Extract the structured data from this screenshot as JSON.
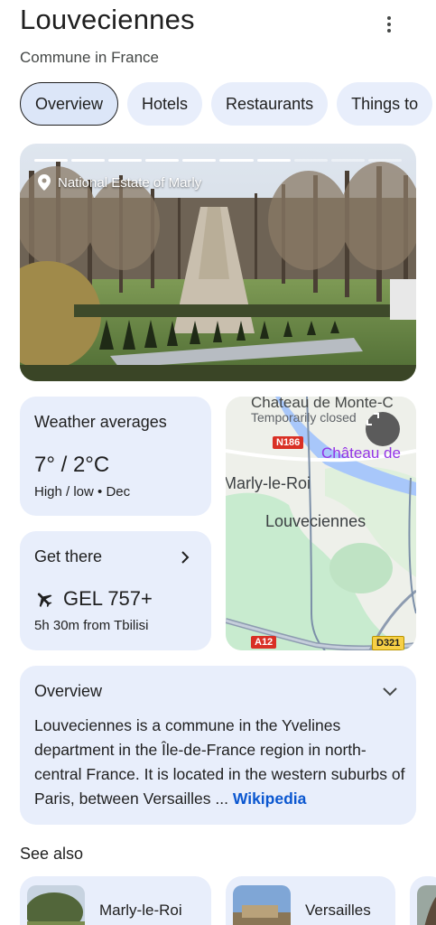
{
  "header": {
    "title": "Louveciennes",
    "subtitle": "Commune in France"
  },
  "chips": [
    {
      "label": "Overview"
    },
    {
      "label": "Hotels"
    },
    {
      "label": "Restaurants"
    },
    {
      "label": "Things to"
    }
  ],
  "hero": {
    "caption": "National Estate of Marly",
    "slides_total": 10,
    "slides_viewed": 7
  },
  "weather": {
    "title": "Weather averages",
    "temperature": "7° / 2°C",
    "detail": "High / low • Dec"
  },
  "get_there": {
    "title": "Get there",
    "price": "GEL 757+",
    "detail": "5h 30m from Tbilisi"
  },
  "map": {
    "place_top": "Chateau de Monte-C",
    "status": "Temporarily closed",
    "poi": "Château de",
    "town_1": "Marly-le-Roi",
    "town_2": "Louveciennes",
    "road_1": "N186",
    "road_2": "A12",
    "road_3": "D321"
  },
  "overview": {
    "title": "Overview",
    "text": "Louveciennes is a commune in the Yvelines department in the Île-de-France region in north-central France. It is located in the western suburbs of Paris, between Versailles ...",
    "source": "Wikipedia"
  },
  "see_also": {
    "title": "See also",
    "items": [
      {
        "name": "Marly-le-Roi"
      },
      {
        "name": "Versailles"
      }
    ]
  },
  "colors": {
    "card_bg": "#e8eefb",
    "link": "#0b57d0",
    "map_water": "#a8c7fa",
    "map_park": "#c8ebcf"
  }
}
